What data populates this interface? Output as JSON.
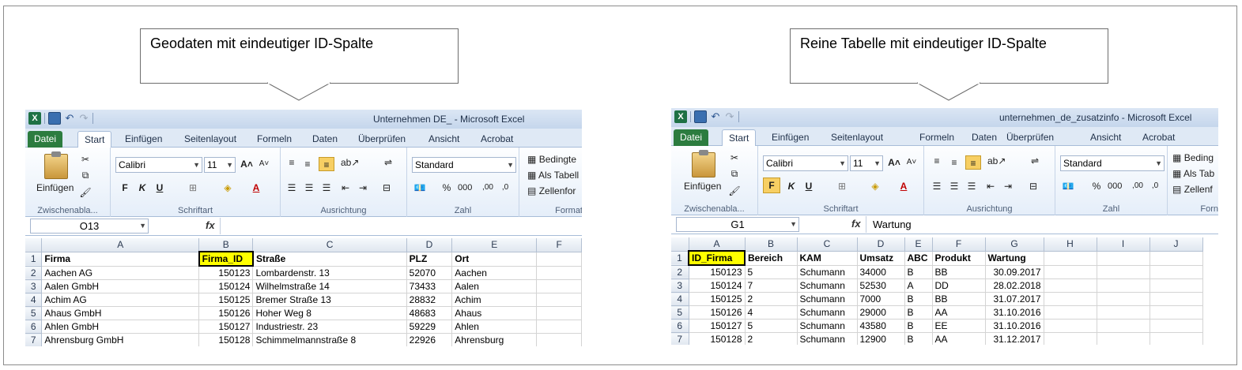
{
  "callouts": [
    {
      "text": "Geodaten mit eindeutiger ID-Spalte"
    },
    {
      "text": "Reine Tabelle mit eindeutiger ID-Spalte"
    }
  ],
  "ribbon": {
    "tabs": [
      "Datei",
      "Start",
      "Einfügen",
      "Seitenlayout",
      "Formeln",
      "Daten",
      "Überprüfen",
      "Ansicht",
      "Acrobat"
    ],
    "groups": {
      "clipboard": "Zwischenabla...",
      "font": "Schriftart",
      "alignment": "Ausrichtung",
      "number": "Zahl",
      "styles_left": "Format",
      "styles_right": "Forn"
    },
    "paste_label": "Einfügen",
    "font_name": "Calibri",
    "font_size": "11",
    "number_format": "Standard",
    "bold": "F",
    "italic": "K",
    "underline": "U",
    "percent": "%",
    "thousands": "000",
    "styles_left": [
      "Bedingte",
      "Als Tabell",
      "Zellenfor"
    ],
    "styles_right": [
      "Beding",
      "Als Tab",
      "Zellenf"
    ]
  },
  "left_window": {
    "title": "Unternehmen DE_ - Microsoft Excel",
    "name_box": "O13",
    "formula": "",
    "columns": [
      "A",
      "B",
      "C",
      "D",
      "E",
      "F"
    ],
    "rows": [
      [
        "1",
        "Firma",
        "Firma_ID",
        "Straße",
        "PLZ",
        "Ort",
        ""
      ],
      [
        "2",
        "Aachen AG",
        "150123",
        "Lombardenstr. 13",
        "52070",
        "Aachen",
        ""
      ],
      [
        "3",
        "Aalen GmbH",
        "150124",
        "Wilhelmstraße 14",
        "73433",
        "Aalen",
        ""
      ],
      [
        "4",
        "Achim AG",
        "150125",
        "Bremer Straße 13",
        "28832",
        "Achim",
        ""
      ],
      [
        "5",
        "Ahaus GmbH",
        "150126",
        "Hoher Weg 8",
        "48683",
        "Ahaus",
        ""
      ],
      [
        "6",
        "Ahlen GmbH",
        "150127",
        "Industriestr. 23",
        "59229",
        "Ahlen",
        ""
      ],
      [
        "7",
        "Ahrensburg GmbH",
        "150128",
        "Schimmelmannstraße 8",
        "22926",
        "Ahrensburg",
        ""
      ]
    ]
  },
  "right_window": {
    "title": "unternehmen_de_zusatzinfo - Microsoft Excel",
    "name_box": "G1",
    "formula": "Wartung",
    "columns": [
      "A",
      "B",
      "C",
      "D",
      "E",
      "F",
      "G",
      "H",
      "I",
      "J"
    ],
    "rows": [
      [
        "1",
        "ID_Firma",
        "Bereich",
        "KAM",
        "Umsatz",
        "ABC",
        "Produkt",
        "Wartung",
        "",
        "",
        ""
      ],
      [
        "2",
        "150123",
        "5",
        "Schumann",
        "34000",
        "B",
        "BB",
        "30.09.2017",
        "",
        "",
        ""
      ],
      [
        "3",
        "150124",
        "7",
        "Schumann",
        "52530",
        "A",
        "DD",
        "28.02.2018",
        "",
        "",
        ""
      ],
      [
        "4",
        "150125",
        "2",
        "Schumann",
        "7000",
        "B",
        "BB",
        "31.07.2017",
        "",
        "",
        ""
      ],
      [
        "5",
        "150126",
        "4",
        "Schumann",
        "29000",
        "B",
        "AA",
        "31.10.2016",
        "",
        "",
        ""
      ],
      [
        "6",
        "150127",
        "5",
        "Schumann",
        "43580",
        "B",
        "EE",
        "31.10.2016",
        "",
        "",
        ""
      ],
      [
        "7",
        "150128",
        "2",
        "Schumann",
        "12900",
        "B",
        "AA",
        "31.12.2017",
        "",
        "",
        ""
      ]
    ]
  }
}
